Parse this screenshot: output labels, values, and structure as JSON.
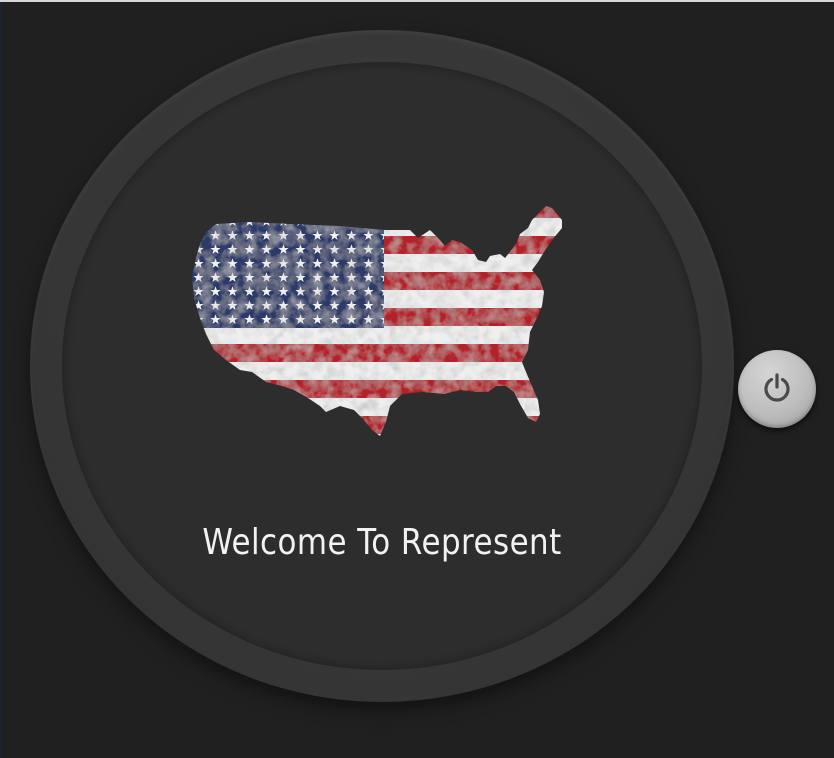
{
  "screen": {
    "welcome_text": "Welcome To Represent"
  },
  "image": {
    "name": "usa-flag-map"
  },
  "controls": {
    "power_icon": "power-icon"
  },
  "colors": {
    "background": "#202020",
    "bezel": "#353535",
    "screen": "#2d2d2d",
    "text": "#f2f2f2",
    "flag_red": "#b3202c",
    "flag_blue": "#2b3a6b",
    "flag_white": "#efefef",
    "button": "#bdbdbd"
  }
}
